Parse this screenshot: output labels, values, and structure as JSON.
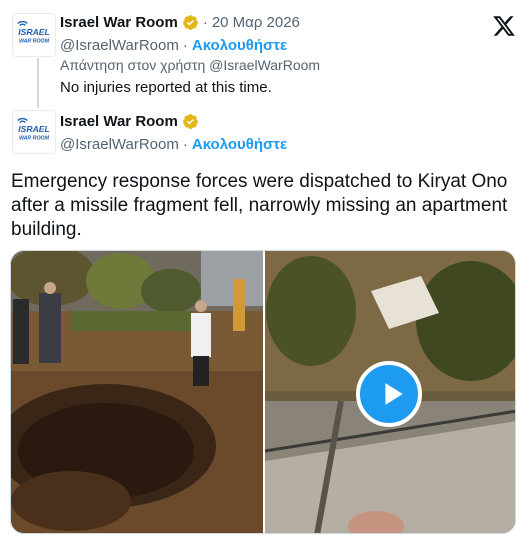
{
  "colors": {
    "accent": "#1d9bf0",
    "verified": "#e2b719",
    "text_primary": "#0f1419",
    "text_secondary": "#536471"
  },
  "reply": {
    "author_name": "Israel War Room",
    "date": "20 Μαρ 2026",
    "handle": "@IsraelWarRoom",
    "follow_label": "Ακολουθήστε",
    "reply_to": "Απάντηση στον χρήστη @IsraelWarRoom",
    "text": "No injuries reported at this time."
  },
  "main": {
    "author_name": "Israel War Room",
    "handle": "@IsraelWarRoom",
    "follow_label": "Ακολουθήστε",
    "text": "Emergency response forces were dispatched to Kiryat Ono after a missile fragment fell, narrowly missing an apartment building."
  },
  "avatar_text": {
    "line1": "ISRAEL",
    "line2": "WAR ROOM"
  },
  "icons": {
    "platform": "x-logo-icon",
    "verified": "verified-badge-icon",
    "play": "play-icon"
  }
}
